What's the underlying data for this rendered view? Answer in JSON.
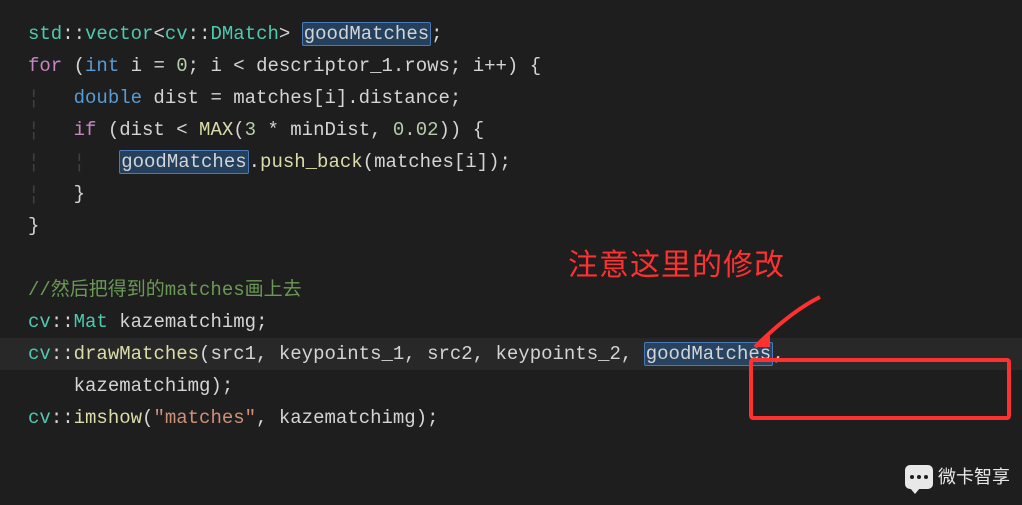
{
  "code": {
    "l1_p1": "std",
    "l1_p2": "::",
    "l1_p3": "vector",
    "l1_p4": "<",
    "l1_p5": "cv",
    "l1_p6": "::",
    "l1_p7": "DMatch",
    "l1_p8": "> ",
    "l1_p9": "goodMatches",
    "l1_p10": ";",
    "l2_p1": "for",
    "l2_p2": " (",
    "l2_p3": "int",
    "l2_p4": " i = ",
    "l2_p5": "0",
    "l2_p6": "; i < descriptor_1.rows; i++) {",
    "l3_p1": "double",
    "l3_p2": " dist = matches[i].distance;",
    "l4_p1": "if",
    "l4_p2": " (dist < ",
    "l4_p3": "MAX",
    "l4_p4": "(",
    "l4_p5": "3",
    "l4_p6": " * minDist, ",
    "l4_p7": "0.02",
    "l4_p8": ")) {",
    "l5_p1": "goodMatches",
    "l5_p2": ".",
    "l5_p3": "push_back",
    "l5_p4": "(matches[i]);",
    "l6_p1": "}",
    "l7_p1": "}",
    "l9_p1": "//然后把得到的matches画上去",
    "l10_p1": "cv",
    "l10_p2": "::",
    "l10_p3": "Mat",
    "l10_p4": " kazematchimg;",
    "l11_p1": "cv",
    "l11_p2": "::",
    "l11_p3": "drawMatches",
    "l11_p4": "(src1, keypoints_1, src2, keypoints_2,",
    "l11_p5": "goodMatches",
    "l11_p6": ",",
    "l12_p1": "kazematchimg);",
    "l13_p1": "cv",
    "l13_p2": "::",
    "l13_p3": "imshow",
    "l13_p4": "(",
    "l13_p5": "\"matches\"",
    "l13_p6": ", kazematchimg);"
  },
  "indent1": "    ",
  "indent2": "        ",
  "annotation": {
    "text": "注意这里的修改"
  },
  "watermark": {
    "text": "微卡智享"
  }
}
